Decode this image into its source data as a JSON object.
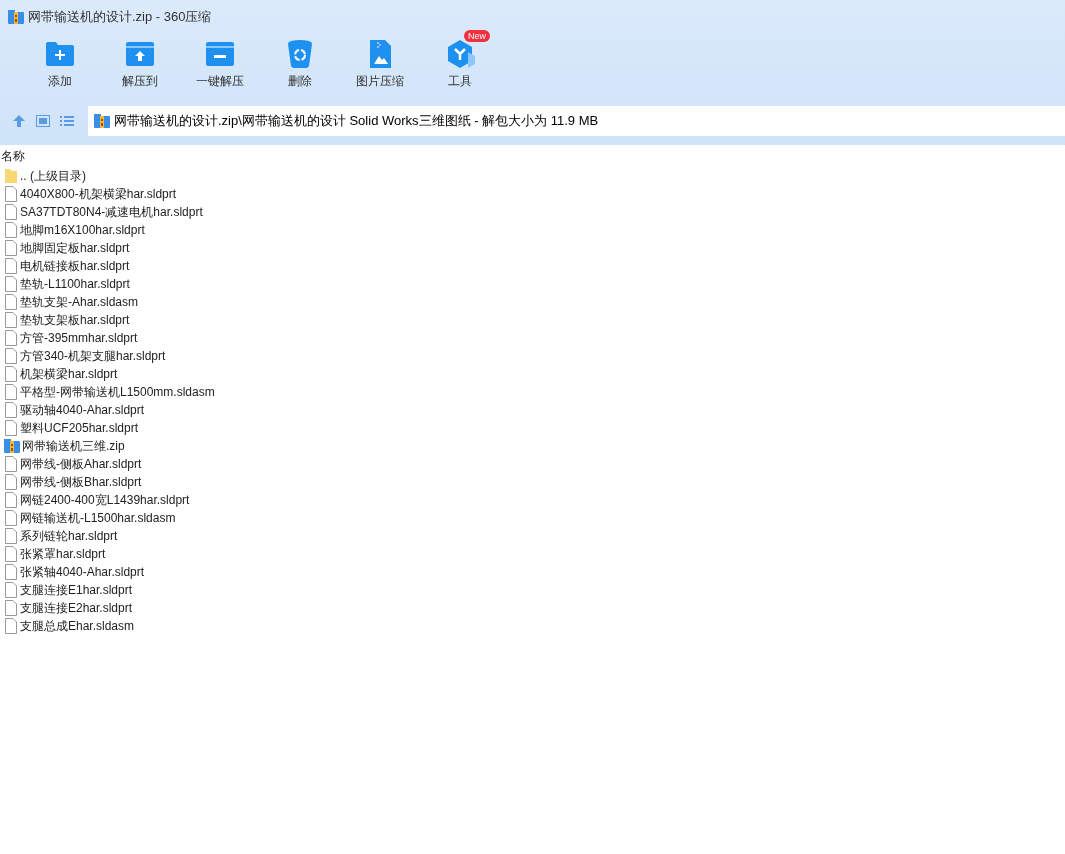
{
  "window": {
    "title": "网带输送机的设计.zip - 360压缩"
  },
  "toolbar": [
    {
      "label": "添加",
      "kind": "add"
    },
    {
      "label": "解压到",
      "kind": "extract"
    },
    {
      "label": "一键解压",
      "kind": "oneclick"
    },
    {
      "label": "删除",
      "kind": "delete"
    },
    {
      "label": "图片压缩",
      "kind": "image"
    },
    {
      "label": "工具",
      "kind": "tools",
      "badge": "New"
    }
  ],
  "address_bar": {
    "path": "网带输送机的设计.zip\\网带输送机的设计 Solid Works三维图纸 - 解包大小为 11.9 MB"
  },
  "file_list": {
    "columns": [
      "名称"
    ],
    "rows": [
      {
        "name": ".. (上级目录)",
        "kind": "parent"
      },
      {
        "name": "4040X800-机架横梁har.sldprt",
        "kind": "file"
      },
      {
        "name": "SA37TDT80N4-减速电机har.sldprt",
        "kind": "file"
      },
      {
        "name": "地脚m16X100har.sldprt",
        "kind": "file"
      },
      {
        "name": "地脚固定板har.sldprt",
        "kind": "file"
      },
      {
        "name": "电机链接板har.sldprt",
        "kind": "file"
      },
      {
        "name": "垫轨-L1100har.sldprt",
        "kind": "file"
      },
      {
        "name": "垫轨支架-Ahar.sldasm",
        "kind": "file"
      },
      {
        "name": "垫轨支架板har.sldprt",
        "kind": "file"
      },
      {
        "name": "方管-395mmhar.sldprt",
        "kind": "file"
      },
      {
        "name": "方管340-机架支腿har.sldprt",
        "kind": "file"
      },
      {
        "name": "机架横梁har.sldprt",
        "kind": "file"
      },
      {
        "name": "平格型-网带输送机L1500mm.sldasm",
        "kind": "file"
      },
      {
        "name": "驱动轴4040-Ahar.sldprt",
        "kind": "file"
      },
      {
        "name": "塑料UCF205har.sldprt",
        "kind": "file"
      },
      {
        "name": "网带输送机三维.zip",
        "kind": "zip"
      },
      {
        "name": "网带线-侧板Ahar.sldprt",
        "kind": "file"
      },
      {
        "name": "网带线-侧板Bhar.sldprt",
        "kind": "file"
      },
      {
        "name": "网链2400-400宽L1439har.sldprt",
        "kind": "file"
      },
      {
        "name": "网链输送机-L1500har.sldasm",
        "kind": "file"
      },
      {
        "name": "系列链轮har.sldprt",
        "kind": "file"
      },
      {
        "name": "张紧罩har.sldprt",
        "kind": "file"
      },
      {
        "name": "张紧轴4040-Ahar.sldprt",
        "kind": "file"
      },
      {
        "name": "支腿连接E1har.sldprt",
        "kind": "file"
      },
      {
        "name": "支腿连接E2har.sldprt",
        "kind": "file"
      },
      {
        "name": "支腿总成Ehar.sldasm",
        "kind": "file"
      }
    ]
  }
}
